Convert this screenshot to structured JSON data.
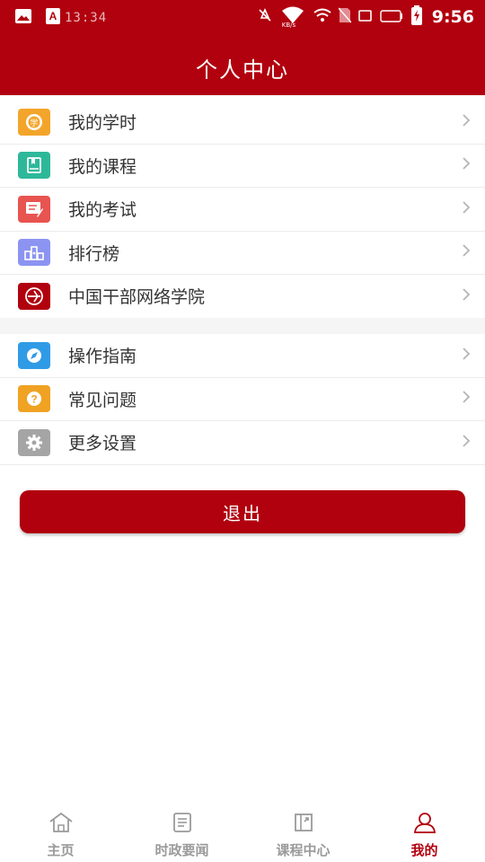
{
  "status_bar": {
    "small_time": "13:34",
    "time": "9:56",
    "speed_unit": "KB/s"
  },
  "header": {
    "title": "个人中心"
  },
  "menu_primary": [
    {
      "label": "我的学时",
      "icon": "study-hours-icon",
      "color": "#f3a52b"
    },
    {
      "label": "我的课程",
      "icon": "book-icon",
      "color": "#2eb89a"
    },
    {
      "label": "我的考试",
      "icon": "exam-icon",
      "color": "#e8544f"
    },
    {
      "label": "排行榜",
      "icon": "ranking-icon",
      "color": "#8c94f2"
    },
    {
      "label": "中国干部网络学院",
      "icon": "college-logo-icon",
      "color": "#b1000e"
    }
  ],
  "menu_secondary": [
    {
      "label": "操作指南",
      "icon": "compass-icon",
      "color": "#2f9be6"
    },
    {
      "label": "常见问题",
      "icon": "question-icon",
      "color": "#f0a223"
    },
    {
      "label": "更多设置",
      "icon": "gear-icon",
      "color": "#a5a5a5"
    }
  ],
  "logout_label": "退出",
  "tabs": [
    {
      "label": "主页",
      "icon": "home-icon",
      "active": false
    },
    {
      "label": "时政要闻",
      "icon": "news-icon",
      "active": false
    },
    {
      "label": "课程中心",
      "icon": "course-center-icon",
      "active": false
    },
    {
      "label": "我的",
      "icon": "profile-icon",
      "active": true
    }
  ],
  "colors": {
    "brand": "#b1000e",
    "inactive_tab": "#9a9a9a"
  }
}
